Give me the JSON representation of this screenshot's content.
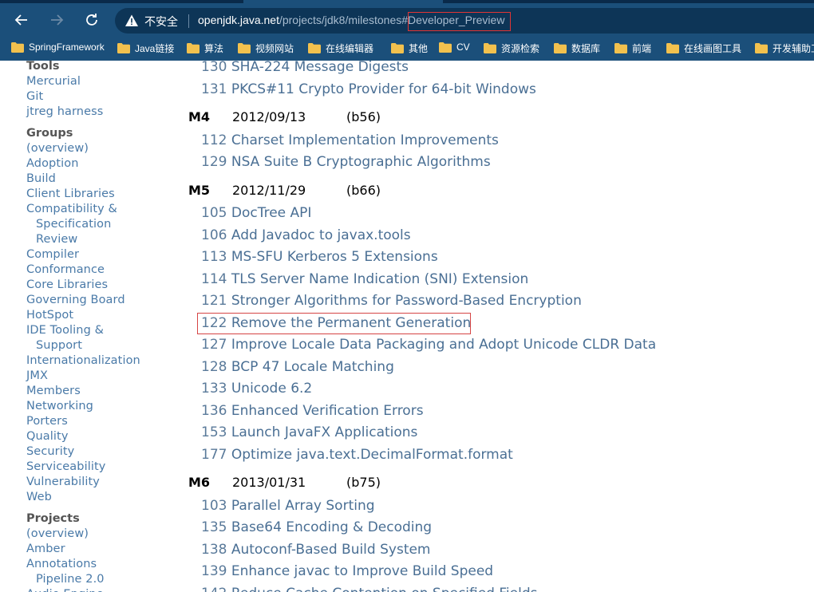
{
  "browser": {
    "security_label": "不安全",
    "url_host": "openjdk.java.net",
    "url_path": "/projects/jdk8/milestones#",
    "url_fragment": "Developer_Preview",
    "bookmarks": [
      "SpringFramework",
      "Java链接",
      "算法",
      "视频网站",
      "在线编辑器",
      "其他",
      "CV",
      "资源检索",
      "数据库",
      "前端",
      "在线画图工具",
      "开发辅助工"
    ]
  },
  "sidebar": {
    "tools_heading": "Tools",
    "tools": [
      "Mercurial",
      "Git",
      "jtreg harness"
    ],
    "groups_heading": "Groups",
    "groups": [
      "(overview)",
      "Adoption",
      "Build",
      "Client Libraries",
      "Compatibility &",
      "Specification",
      "Review",
      "Compiler",
      "Conformance",
      "Core Libraries",
      "Governing Board",
      "HotSpot",
      "IDE Tooling &",
      "Support",
      "Internationalization",
      "JMX",
      "Members",
      "Networking",
      "Porters",
      "Quality",
      "Security",
      "Serviceability",
      "Vulnerability",
      "Web"
    ],
    "projects_heading": "Projects",
    "projects": [
      "(overview)",
      "Amber",
      "Annotations",
      "Pipeline 2.0",
      "Audio Engine"
    ]
  },
  "main": {
    "top_jeps": [
      {
        "num": "130",
        "title": "SHA-224 Message Digests"
      },
      {
        "num": "131",
        "title": "PKCS#11 Crypto Provider for 64-bit Windows"
      }
    ],
    "milestones": [
      {
        "name": "M4",
        "date": "2012/09/13",
        "build": "(b56)",
        "jeps": [
          {
            "num": "112",
            "title": "Charset Implementation Improvements"
          },
          {
            "num": "129",
            "title": "NSA Suite B Cryptographic Algorithms"
          }
        ]
      },
      {
        "name": "M5",
        "date": "2012/11/29",
        "build": "(b66)",
        "jeps": [
          {
            "num": "105",
            "title": "DocTree API"
          },
          {
            "num": "106",
            "title": "Add Javadoc to javax.tools"
          },
          {
            "num": "113",
            "title": "MS-SFU Kerberos 5 Extensions"
          },
          {
            "num": "114",
            "title": "TLS Server Name Indication (SNI) Extension"
          },
          {
            "num": "121",
            "title": "Stronger Algorithms for Password-Based Encryption"
          },
          {
            "num": "122",
            "title": "Remove the Permanent Generation"
          },
          {
            "num": "127",
            "title": "Improve Locale Data Packaging and Adopt Unicode CLDR Data"
          },
          {
            "num": "128",
            "title": "BCP 47 Locale Matching"
          },
          {
            "num": "133",
            "title": "Unicode 6.2"
          },
          {
            "num": "136",
            "title": "Enhanced Verification Errors"
          },
          {
            "num": "153",
            "title": "Launch JavaFX Applications"
          },
          {
            "num": "177",
            "title": "Optimize java.text.DecimalFormat.format"
          }
        ]
      },
      {
        "name": "M6",
        "date": "2013/01/31",
        "build": "(b75)",
        "jeps": [
          {
            "num": "103",
            "title": "Parallel Array Sorting"
          },
          {
            "num": "135",
            "title": "Base64 Encoding & Decoding"
          },
          {
            "num": "138",
            "title": "Autoconf-Based Build System"
          },
          {
            "num": "139",
            "title": "Enhance javac to Improve Build Speed"
          },
          {
            "num": "142",
            "title": "Reduce Cache Contention on Specified Fields"
          }
        ]
      }
    ]
  }
}
